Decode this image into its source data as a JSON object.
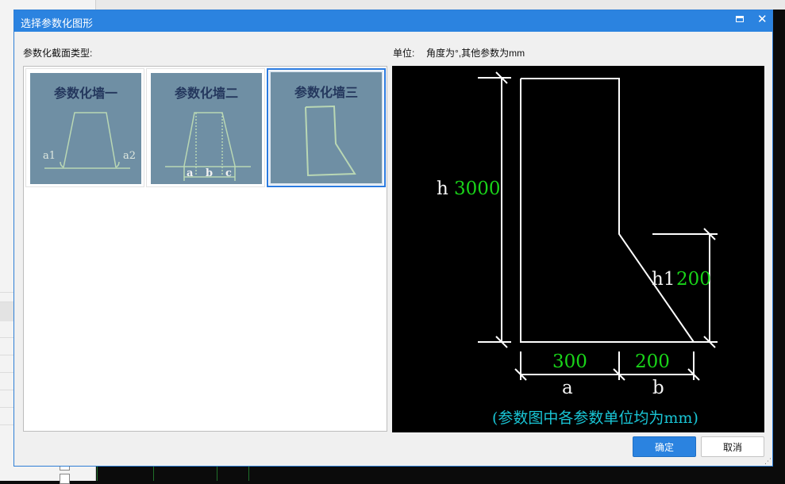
{
  "window": {
    "title": "选择参数化图形"
  },
  "labels": {
    "section_type": "参数化截面类型:",
    "unit_prefix": "单位:",
    "unit_text": "角度为°,其他参数为mm"
  },
  "thumbnails": [
    {
      "name": "参数化墙一",
      "tags": [
        "a1",
        "a2"
      ],
      "selected": false
    },
    {
      "name": "参数化墙二",
      "tags": [
        "a",
        "b",
        "c"
      ],
      "selected": false
    },
    {
      "name": "参数化墙三",
      "tags": [],
      "selected": true
    }
  ],
  "preview": {
    "h_label": "h",
    "h_value": "3000",
    "h1_label": "h1",
    "h1_value": "200",
    "a_label": "a",
    "a_value": "300",
    "b_label": "b",
    "b_value": "200",
    "note": "(参数图中各参数单位均为mm)"
  },
  "buttons": {
    "ok": "确定",
    "cancel": "取消"
  },
  "colors": {
    "titlebar": "#2b83e0",
    "selection": "#2b7be0",
    "dim_value": "#19d419",
    "note": "#19c6d6",
    "thumb_bg": "#6f8fa4"
  }
}
